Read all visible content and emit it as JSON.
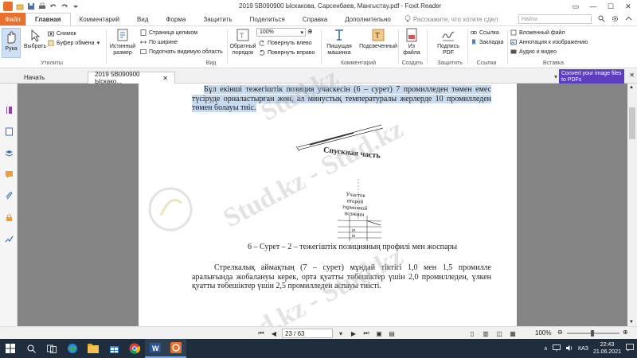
{
  "window": {
    "title": "2019 5В090900 Ыскакова, Сарсенбаев, Мангыстау.pdf - Foxit Reader"
  },
  "menu": {
    "file": "Файл",
    "tabs": [
      "Главная",
      "Комментарий",
      "Вид",
      "Форма",
      "Защитить",
      "Поделиться",
      "Справка",
      "Дополнительно"
    ],
    "tell_me": "Расскажите, что хотите сдел",
    "search_placeholder": "Найти"
  },
  "ribbon": {
    "hand": "Рука",
    "select": "Выбрать",
    "snapshot": "Снимок",
    "clipboard": "Буфер обмена",
    "tools_group": "Утилиты",
    "actual_size": "Истинный размер",
    "fit_page": "Страница целиком",
    "fit_width": "По ширине",
    "fit_visible": "Подогнать видимую область",
    "view_group": "Вид",
    "reflow": "Обратный порядок",
    "zoom_value": "100%",
    "rotate_left": "Повернуть влево",
    "rotate_right": "Повернуть вправо",
    "typewriter": "Пишущая машинка",
    "highlight": "Подсвеченный",
    "comment_group": "Комментарий",
    "from_file": "Из файла",
    "create_group": "Создать",
    "sign_pdf": "Подпись PDF",
    "protect_group": "Защитить",
    "link": "Ссылка",
    "bookmark": "Закладка",
    "links_group": "Ссылки",
    "attached_file": "Вложенный файл",
    "image_annotation": "Аннотация к изображению",
    "audio_video": "Аудио и видео",
    "insert_group": "Вставка"
  },
  "doc_tabs": {
    "start": "Начать",
    "current": "2019 5В090900 Ыскако..."
  },
  "ad": {
    "text": "Convert your image files to PDFs"
  },
  "document": {
    "para1": "Бұл екінші тежегіштік позиция учаскесін (6 – сурет) 7 промилледен төмен емес түсіруде орналастырған жөн, ал минустық температуралы жерлерде 10 промилледен төмен болауы тиіс.",
    "figure_label_1": "Спускная часть",
    "figure_label_2": [
      "Участок",
      "второй",
      "тормозной",
      "позиции"
    ],
    "figure_label_3": [
      "ie",
      "ie"
    ],
    "caption": "6 – Сурет – 2 – тежегіштік позицияның профилі мен жоспары",
    "para2": "Стрелкалық аймақтың (7 – сурет) мұндай тіктігі 1,0 мен 1,5 промилле аралығында жобалануы керек, орта қуатты төбешіктер үшін 2,0 промилледен, үлкен қуатты төбешіктер үшін 2,5 промилледен аспауы тиісті.",
    "watermarks": [
      "Stud.kz",
      "Stud.kz - Stud.kz",
      "Stud.kz - Stud.kz"
    ]
  },
  "status": {
    "page": "23 / 63",
    "zoom": "100%"
  },
  "taskbar": {
    "lang": "КАЗ",
    "time": "22:43",
    "date": "21.06.2021"
  }
}
